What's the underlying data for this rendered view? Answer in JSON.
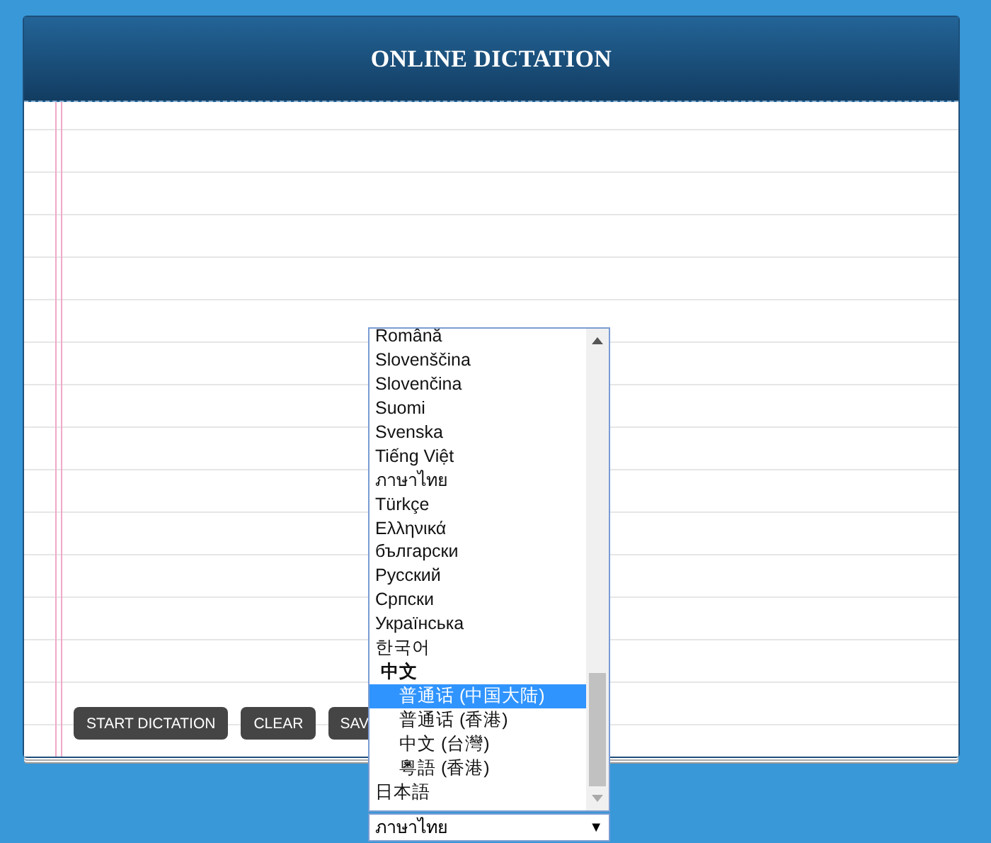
{
  "header": {
    "title": "ONLINE DICTATION"
  },
  "buttons": [
    {
      "label": "START DICTATION"
    },
    {
      "label": "CLEAR"
    },
    {
      "label": "SAV"
    }
  ],
  "language_list": {
    "items": [
      {
        "kind": "option",
        "label": "Română",
        "selected": false
      },
      {
        "kind": "option",
        "label": "Slovenščina",
        "selected": false
      },
      {
        "kind": "option",
        "label": "Slovenčina",
        "selected": false
      },
      {
        "kind": "option",
        "label": "Suomi",
        "selected": false
      },
      {
        "kind": "option",
        "label": "Svenska",
        "selected": false
      },
      {
        "kind": "option",
        "label": "Tiếng Việt",
        "selected": false
      },
      {
        "kind": "option",
        "label": "ภาษาไทย",
        "selected": false
      },
      {
        "kind": "option",
        "label": "Türkçe",
        "selected": false
      },
      {
        "kind": "option",
        "label": "Ελληνικά",
        "selected": false
      },
      {
        "kind": "option",
        "label": "български",
        "selected": false
      },
      {
        "kind": "option",
        "label": "Русский",
        "selected": false
      },
      {
        "kind": "option",
        "label": "Српски",
        "selected": false
      },
      {
        "kind": "option",
        "label": "Українська",
        "selected": false
      },
      {
        "kind": "option",
        "label": "한국어",
        "selected": false
      },
      {
        "kind": "group",
        "label": "中文",
        "selected": false,
        "children": [
          {
            "kind": "option",
            "label": "普通话 (中国大陆)",
            "selected": true
          },
          {
            "kind": "option",
            "label": "普通话 (香港)",
            "selected": false
          },
          {
            "kind": "option",
            "label": "中文 (台灣)",
            "selected": false
          },
          {
            "kind": "option",
            "label": "粵語 (香港)",
            "selected": false
          }
        ]
      },
      {
        "kind": "option",
        "label": "日本語",
        "selected": false
      }
    ]
  },
  "language_select": {
    "value": "ภาษาไทย",
    "arrow": "▼"
  }
}
